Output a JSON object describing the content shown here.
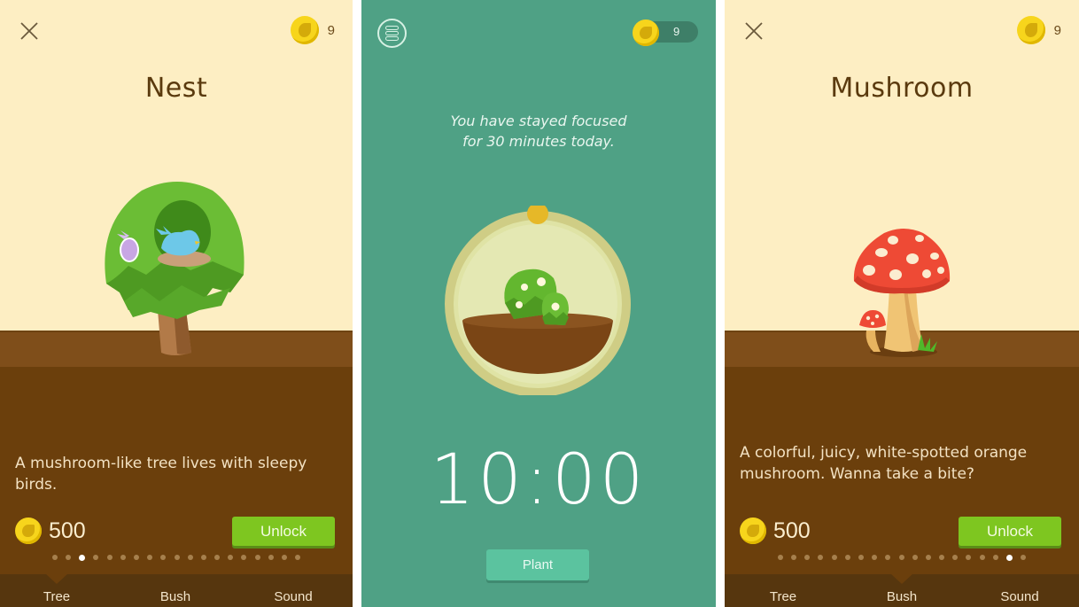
{
  "screens": {
    "left": {
      "title": "Nest",
      "coins": "9",
      "description": "A mushroom-like tree lives with sleepy birds.",
      "price": "500",
      "unlock_label": "Unlock",
      "page_dots": {
        "total": 19,
        "active_index": 2
      },
      "tabs": [
        {
          "label": "Tree",
          "selected": true
        },
        {
          "label": "Bush",
          "selected": false
        },
        {
          "label": "Sound",
          "selected": false
        }
      ],
      "illustration": "nest-tree"
    },
    "middle": {
      "coins": "9",
      "focus_message_line1": "You have stayed focused",
      "focus_message_line2": "for 30 minutes today.",
      "timer": "10:00",
      "plant_label": "Plant",
      "illustration": "flowering-bush"
    },
    "right": {
      "title": "Mushroom",
      "coins": "9",
      "description": "A colorful, juicy, white-spotted orange mushroom. Wanna take a bite?",
      "price": "500",
      "unlock_label": "Unlock",
      "page_dots": {
        "total": 19,
        "active_index": 17
      },
      "tabs": [
        {
          "label": "Tree",
          "selected": false
        },
        {
          "label": "Bush",
          "selected": true
        },
        {
          "label": "Sound",
          "selected": false
        }
      ],
      "illustration": "mushroom"
    }
  },
  "colors": {
    "sky": "#fdeec3",
    "ground": "#6b3f0c",
    "ground_light": "#7f4e1a",
    "tab_bar": "#56360e",
    "timer_bg": "#4fa185",
    "unlock_green": "#7ec620",
    "plant_button": "#5bc39f",
    "coin_gold": "#f7d51c"
  }
}
